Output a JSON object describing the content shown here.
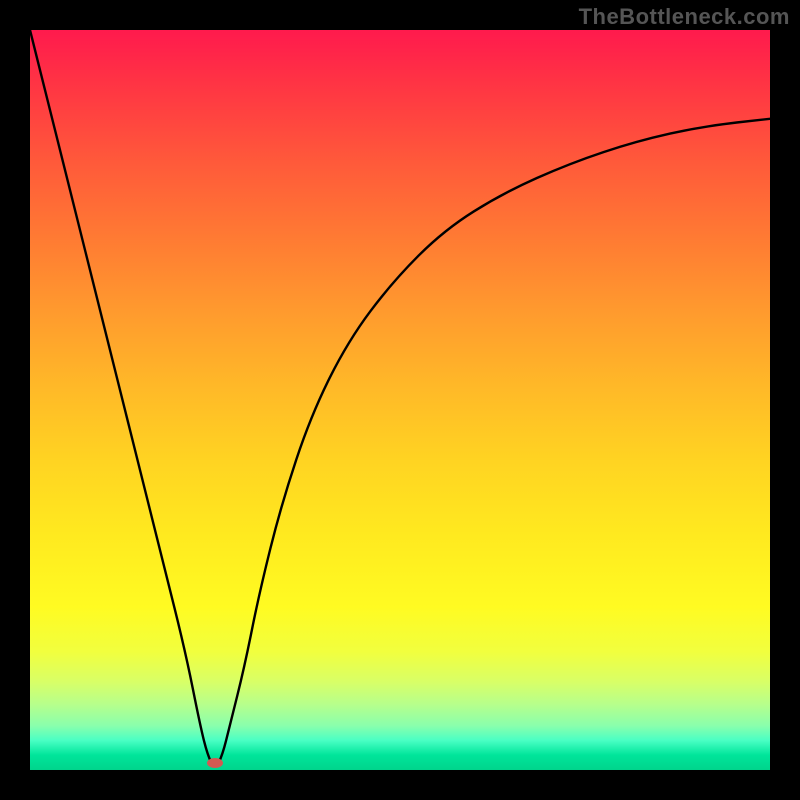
{
  "watermark": "TheBottleneck.com",
  "chart_data": {
    "type": "line",
    "title": "",
    "xlabel": "",
    "ylabel": "",
    "xlim": [
      0,
      100
    ],
    "ylim": [
      0,
      100
    ],
    "grid": false,
    "series": [
      {
        "name": "curve",
        "x": [
          0,
          3,
          6,
          9,
          12,
          15,
          18,
          21,
          23,
          24,
          25,
          26,
          27,
          29,
          31,
          34,
          38,
          43,
          49,
          56,
          64,
          73,
          82,
          91,
          100
        ],
        "y": [
          100,
          88,
          76,
          64,
          52,
          40,
          28,
          16,
          6,
          2,
          0,
          2,
          6,
          14,
          24,
          36,
          48,
          58,
          66,
          73,
          78,
          82,
          85,
          87,
          88
        ]
      }
    ],
    "marker": {
      "x": 25,
      "y": 1
    },
    "background_gradient": {
      "top": "#ff1a4d",
      "bottom": "#00d48c"
    }
  }
}
